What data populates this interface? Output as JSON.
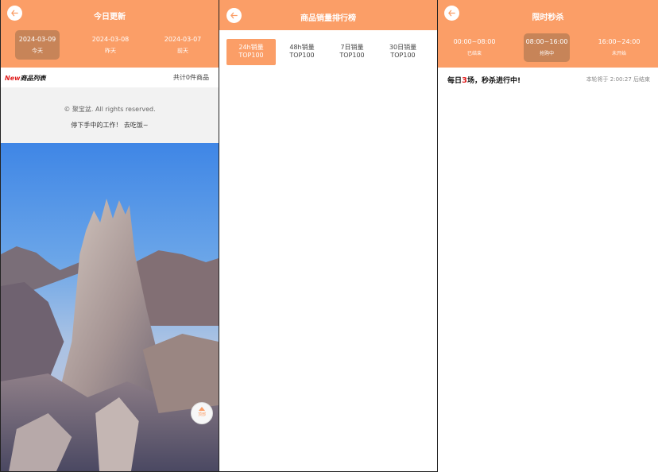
{
  "panel1": {
    "title": "今日更新",
    "dates": [
      {
        "date": "2024-03-09",
        "label": "今天"
      },
      {
        "date": "2024-03-08",
        "label": "昨天"
      },
      {
        "date": "2024-03-07",
        "label": "前天"
      }
    ],
    "list_logo_new": "New",
    "list_logo_text": "商品列表",
    "count_text": "共计0件商品",
    "copyright": "© 聚宝盆. All rights reserved.",
    "slogan": "停下手中的工作！ 去吃饭~",
    "top_button": "顶部"
  },
  "panel2": {
    "title": "商品销量排行榜",
    "tabs": [
      {
        "line1": "24h销量",
        "line2": "TOP100"
      },
      {
        "line1": "48h销量",
        "line2": "TOP100"
      },
      {
        "line1": "7日销量",
        "line2": "TOP100"
      },
      {
        "line1": "30日销量",
        "line2": "TOP100"
      }
    ]
  },
  "panel3": {
    "title": "限时秒杀",
    "slots": [
      {
        "time": "00:00~08:00",
        "status": "已结束"
      },
      {
        "time": "08:00~16:00",
        "status": "抢购中"
      },
      {
        "time": "16:00~24:00",
        "status": "未开始"
      }
    ],
    "daily_prefix": "每日",
    "daily_num": "3",
    "daily_suffix": "场，秒杀进行中!",
    "ends_text": "本轮将于 2:00:27 后结束"
  },
  "colors": {
    "accent": "#fb9e67",
    "active_tab": "#c78458"
  }
}
